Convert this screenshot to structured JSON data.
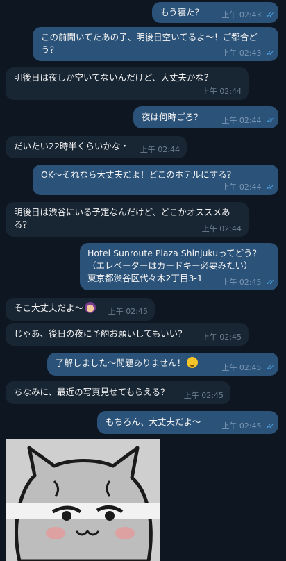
{
  "messages": [
    {
      "dir": "out",
      "text": "もう寝た？",
      "time": "上午 02:43",
      "read": true
    },
    {
      "dir": "out",
      "text": "この前聞いてたあの子、明後日空いてるよ～！ご都合ど\nう？",
      "time": "上午 02:43",
      "read": true
    },
    {
      "dir": "in",
      "text": "明後日は夜しか空いてないんだけど、大丈夫かな？",
      "time": "上午 02:44"
    },
    {
      "dir": "out",
      "text": "夜は何時ごろ？",
      "time": "上午 02:44",
      "read": true
    },
    {
      "dir": "in",
      "text": "だいたい22時半くらいかな・",
      "time": "上午 02:44"
    },
    {
      "dir": "out",
      "text": "OK～それなら大丈夫だよ！どこのホテルにする？",
      "time": "上午 02:44",
      "read": true
    },
    {
      "dir": "in",
      "text": "明後日は渋谷にいる予定なんだけど、どこかオススメあ\nる？",
      "time": "上午 02:44"
    },
    {
      "dir": "out",
      "text": "Hotel Sunroute Plaza Shinjukuってどう？\n（エレベーターはカードキー必要みたい）\n東京都渋谷区代々木2丁目3-1",
      "time": "上午 02:45",
      "read": true
    },
    {
      "dir": "in",
      "text": "そこ大丈夫だよ～",
      "time": "上午 02:45",
      "emoji": "girl-emoji"
    },
    {
      "dir": "in",
      "text": "じゃあ、後日の夜に予約お願いしてもいい？",
      "time": "上午 02:45"
    },
    {
      "dir": "out",
      "text": "了解しました～問題ありません！",
      "time": "上午 02:45",
      "read": true,
      "emoji": "smile-emoji"
    },
    {
      "dir": "in",
      "text": "ちなみに、最近の写真見せてもらえる？",
      "time": "上午 02:45"
    },
    {
      "dir": "out",
      "text": "もちろん、大丈夫だよ～",
      "time": "上午 02:45",
      "read": true
    }
  ],
  "photo": {
    "description_icon": "cat-illustration-icon"
  },
  "colors": {
    "background": "#0e1621",
    "outgoing": "#2b5278",
    "incoming": "#182533",
    "check": "#4fa3e0"
  },
  "read_mark": "✓✓"
}
